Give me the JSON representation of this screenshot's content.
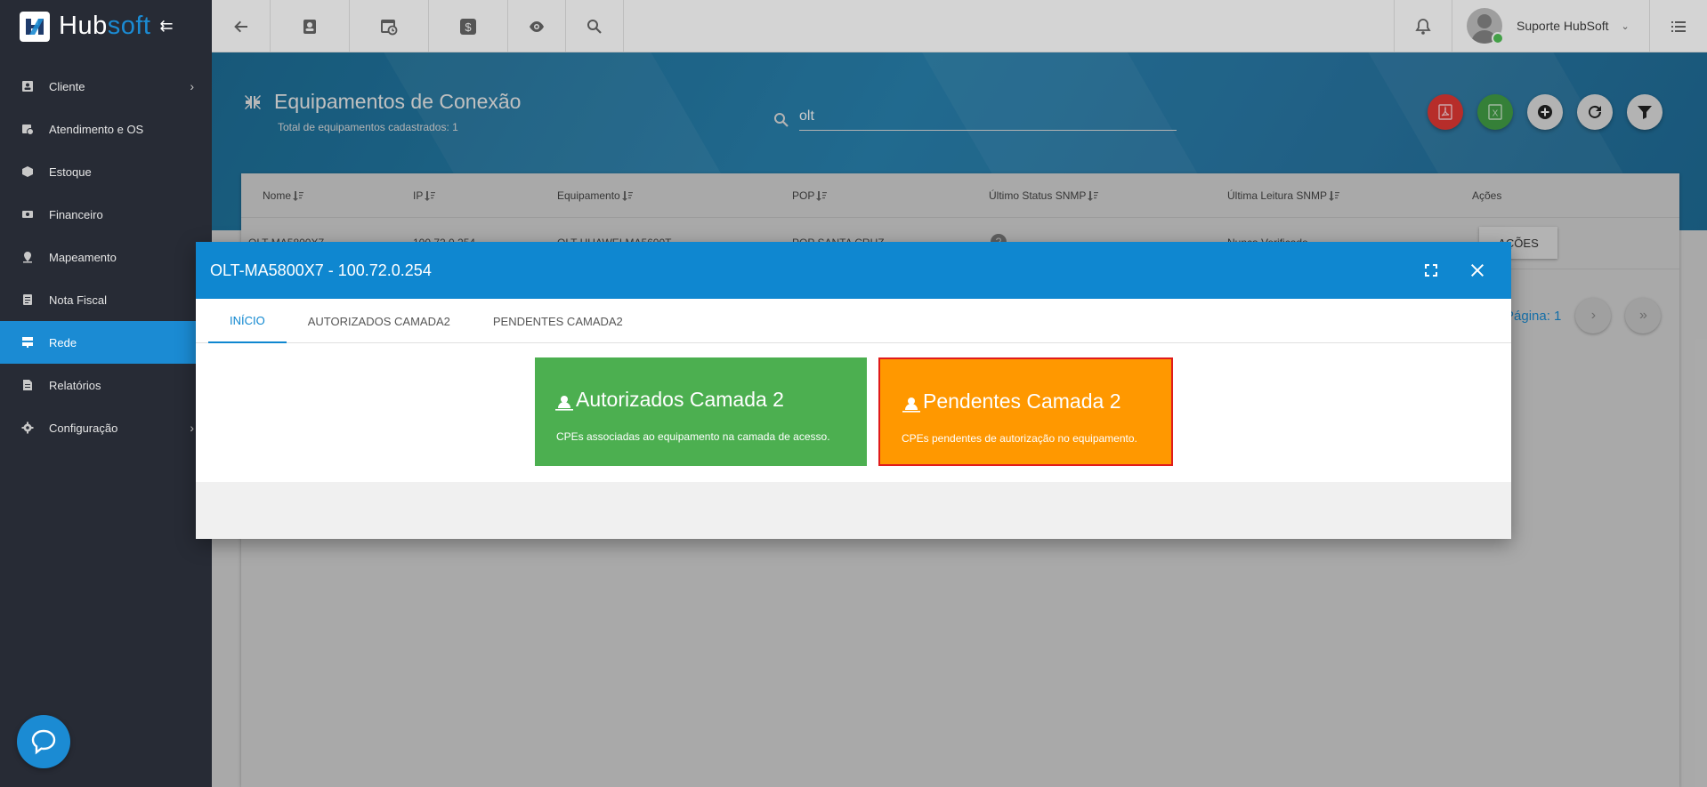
{
  "app": {
    "logo_hub": "Hub",
    "logo_soft": "soft"
  },
  "sidebar": {
    "items": [
      {
        "label": "Cliente",
        "icon": "contact-card-icon",
        "has_submenu": true
      },
      {
        "label": "Atendimento e OS",
        "icon": "calendar-clock-icon"
      },
      {
        "label": "Estoque",
        "icon": "box-icon"
      },
      {
        "label": "Financeiro",
        "icon": "money-icon"
      },
      {
        "label": "Mapeamento",
        "icon": "map-pin-icon"
      },
      {
        "label": "Nota Fiscal",
        "icon": "document-icon"
      },
      {
        "label": "Rede",
        "icon": "server-icon",
        "active": true
      },
      {
        "label": "Relatórios",
        "icon": "report-icon"
      },
      {
        "label": "Configuração",
        "icon": "gear-icon",
        "has_submenu": true
      }
    ]
  },
  "topbar": {
    "user_name": "Suporte HubSoft"
  },
  "page": {
    "title": "Equipamentos de Conexão",
    "subtitle": "Total de equipamentos cadastrados: 1",
    "search_value": "olt"
  },
  "table": {
    "columns": [
      "Nome",
      "IP",
      "Equipamento",
      "POP",
      "Último Status SNMP",
      "Última Leitura SNMP",
      "Ações"
    ],
    "row": {
      "nome": "OLT-MA5800X7",
      "ip": "100.72.0.254",
      "equipamento": "OLT HUAWEI MA5600T",
      "pop": "POP SANTA CRUZ",
      "ultima_leitura": "Nunca Verificado",
      "acoes_label": "AÇÕES"
    },
    "pager_label": "Página: 1"
  },
  "modal": {
    "title": "OLT-MA5800X7 - 100.72.0.254",
    "tabs": [
      "INÍCIO",
      "AUTORIZADOS CAMADA2",
      "PENDENTES CAMADA2"
    ],
    "active_tab": 0,
    "tiles": [
      {
        "title": "Autorizados Camada 2",
        "desc": "CPEs associadas ao equipamento na camada de acesso.",
        "color": "#4caf50"
      },
      {
        "title": "Pendentes Camada 2",
        "desc": "CPEs pendentes de autorização no equipamento.",
        "color": "#ff9800"
      }
    ]
  },
  "colors": {
    "accent": "#1b8bd3",
    "sidebar_bg": "#272b35",
    "modal_header": "#0f87d0",
    "pdf_red": "#e53935",
    "excel_green": "#43a047"
  }
}
